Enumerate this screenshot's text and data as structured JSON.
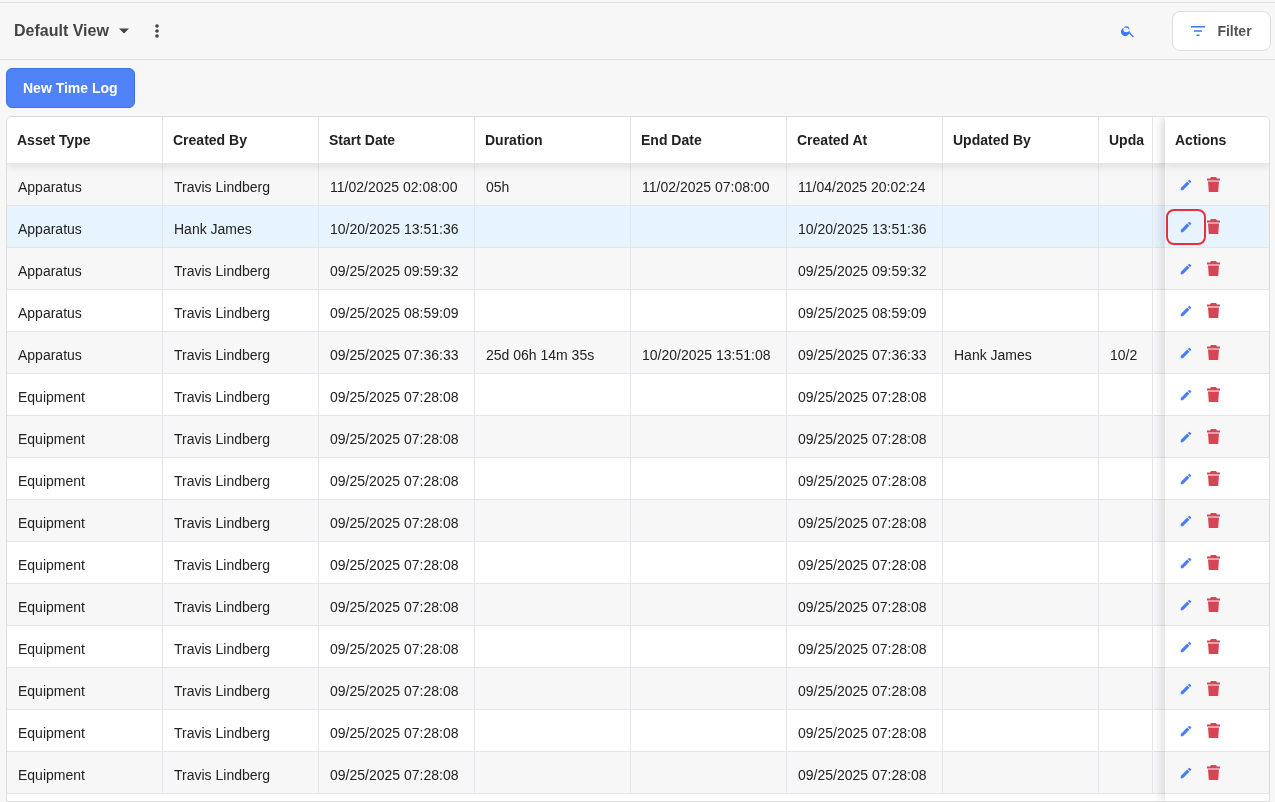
{
  "toolbar": {
    "view_title": "Default View",
    "filter_label": "Filter"
  },
  "new_button": "New Time Log",
  "table": {
    "columns": [
      "Asset Type",
      "Created By",
      "Start Date",
      "Duration",
      "End Date",
      "Created At",
      "Updated By",
      "Upda",
      "Actions"
    ],
    "rows": [
      {
        "cells": [
          "Apparatus",
          "Travis Lindberg",
          "11/02/2025 02:08:00",
          "05h",
          "11/02/2025 07:08:00",
          "11/04/2025 20:02:24",
          "",
          ""
        ],
        "selected": false,
        "edit_highlighted": false
      },
      {
        "cells": [
          "Apparatus",
          "Hank James",
          "10/20/2025 13:51:36",
          "",
          "",
          "10/20/2025 13:51:36",
          "",
          ""
        ],
        "selected": true,
        "edit_highlighted": true
      },
      {
        "cells": [
          "Apparatus",
          "Travis Lindberg",
          "09/25/2025 09:59:32",
          "",
          "",
          "09/25/2025 09:59:32",
          "",
          ""
        ],
        "selected": false,
        "edit_highlighted": false
      },
      {
        "cells": [
          "Apparatus",
          "Travis Lindberg",
          "09/25/2025 08:59:09",
          "",
          "",
          "09/25/2025 08:59:09",
          "",
          ""
        ],
        "selected": false,
        "edit_highlighted": false
      },
      {
        "cells": [
          "Apparatus",
          "Travis Lindberg",
          "09/25/2025 07:36:33",
          "25d 06h 14m 35s",
          "10/20/2025 13:51:08",
          "09/25/2025 07:36:33",
          "Hank James",
          "10/2"
        ],
        "selected": false,
        "edit_highlighted": false
      },
      {
        "cells": [
          "Equipment",
          "Travis Lindberg",
          "09/25/2025 07:28:08",
          "",
          "",
          "09/25/2025 07:28:08",
          "",
          ""
        ],
        "selected": false,
        "edit_highlighted": false
      },
      {
        "cells": [
          "Equipment",
          "Travis Lindberg",
          "09/25/2025 07:28:08",
          "",
          "",
          "09/25/2025 07:28:08",
          "",
          ""
        ],
        "selected": false,
        "edit_highlighted": false
      },
      {
        "cells": [
          "Equipment",
          "Travis Lindberg",
          "09/25/2025 07:28:08",
          "",
          "",
          "09/25/2025 07:28:08",
          "",
          ""
        ],
        "selected": false,
        "edit_highlighted": false
      },
      {
        "cells": [
          "Equipment",
          "Travis Lindberg",
          "09/25/2025 07:28:08",
          "",
          "",
          "09/25/2025 07:28:08",
          "",
          ""
        ],
        "selected": false,
        "edit_highlighted": false
      },
      {
        "cells": [
          "Equipment",
          "Travis Lindberg",
          "09/25/2025 07:28:08",
          "",
          "",
          "09/25/2025 07:28:08",
          "",
          ""
        ],
        "selected": false,
        "edit_highlighted": false
      },
      {
        "cells": [
          "Equipment",
          "Travis Lindberg",
          "09/25/2025 07:28:08",
          "",
          "",
          "09/25/2025 07:28:08",
          "",
          ""
        ],
        "selected": false,
        "edit_highlighted": false
      },
      {
        "cells": [
          "Equipment",
          "Travis Lindberg",
          "09/25/2025 07:28:08",
          "",
          "",
          "09/25/2025 07:28:08",
          "",
          ""
        ],
        "selected": false,
        "edit_highlighted": false
      },
      {
        "cells": [
          "Equipment",
          "Travis Lindberg",
          "09/25/2025 07:28:08",
          "",
          "",
          "09/25/2025 07:28:08",
          "",
          ""
        ],
        "selected": false,
        "edit_highlighted": false
      },
      {
        "cells": [
          "Equipment",
          "Travis Lindberg",
          "09/25/2025 07:28:08",
          "",
          "",
          "09/25/2025 07:28:08",
          "",
          ""
        ],
        "selected": false,
        "edit_highlighted": false
      },
      {
        "cells": [
          "Equipment",
          "Travis Lindberg",
          "09/25/2025 07:28:08",
          "",
          "",
          "09/25/2025 07:28:08",
          "",
          ""
        ],
        "selected": false,
        "edit_highlighted": false
      }
    ]
  }
}
